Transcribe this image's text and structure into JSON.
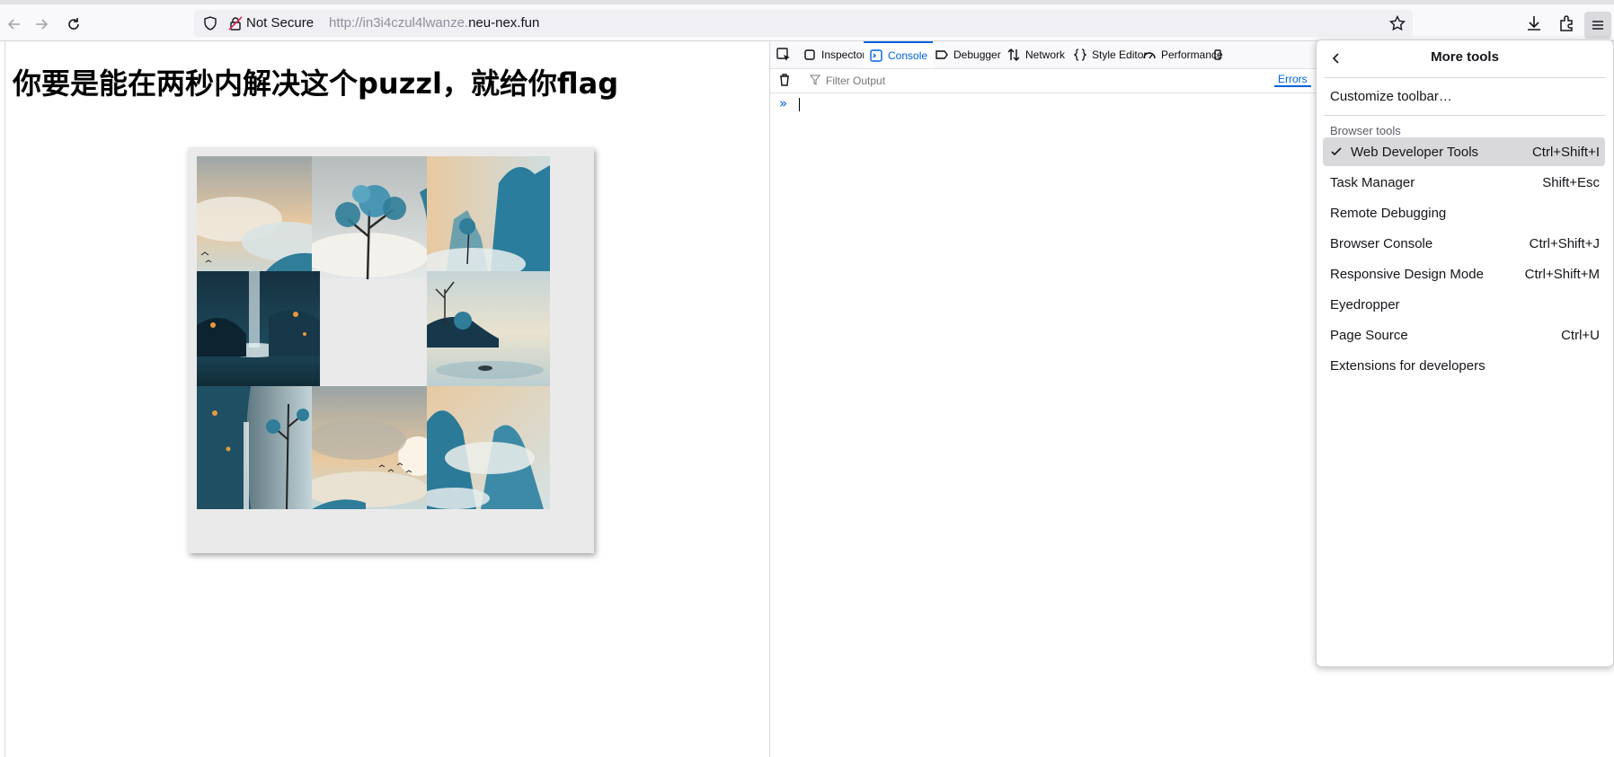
{
  "browser": {
    "url": {
      "not_secure_label": "Not Secure",
      "prefix": "http://in3i4czul4lwanze.",
      "host": "neu-nex.fun"
    }
  },
  "page": {
    "title": "你要是能在两秒内解决这个puzzl，就给你flag",
    "puzzle": {
      "tiles": [
        {
          "name": "puzzle-tile-clouds-birds",
          "empty": false
        },
        {
          "name": "puzzle-tile-blue-tree",
          "empty": false
        },
        {
          "name": "puzzle-tile-blue-mountains",
          "empty": false
        },
        {
          "name": "puzzle-tile-night-waterfall-lake",
          "empty": false
        },
        {
          "name": "puzzle-tile-empty",
          "empty": true
        },
        {
          "name": "puzzle-tile-island-lake",
          "empty": false
        },
        {
          "name": "puzzle-tile-waterfall-cliff",
          "empty": false
        },
        {
          "name": "puzzle-tile-sun-birds",
          "empty": false
        },
        {
          "name": "puzzle-tile-misty-peaks",
          "empty": false
        }
      ]
    }
  },
  "devtools": {
    "tabs": [
      {
        "label": "Inspector",
        "active": false
      },
      {
        "label": "Console",
        "active": true
      },
      {
        "label": "Debugger",
        "active": false
      },
      {
        "label": "Network",
        "active": false
      },
      {
        "label": "Style Editor",
        "active": false
      },
      {
        "label": "Performance",
        "active": false
      }
    ],
    "filter_placeholder": "Filter Output",
    "errors_label": "Errors",
    "prompt_symbol": "»"
  },
  "menu": {
    "title": "More tools",
    "customize": "Customize toolbar…",
    "section_label": "Browser tools",
    "items": [
      {
        "label": "Web Developer Tools",
        "shortcut": "Ctrl+Shift+I",
        "checked": true
      },
      {
        "label": "Task Manager",
        "shortcut": "Shift+Esc",
        "checked": false
      },
      {
        "label": "Remote Debugging",
        "shortcut": "",
        "checked": false
      },
      {
        "label": "Browser Console",
        "shortcut": "Ctrl+Shift+J",
        "checked": false
      },
      {
        "label": "Responsive Design Mode",
        "shortcut": "Ctrl+Shift+M",
        "checked": false
      },
      {
        "label": "Eyedropper",
        "shortcut": "",
        "checked": false
      },
      {
        "label": "Page Source",
        "shortcut": "Ctrl+U",
        "checked": false
      },
      {
        "label": "Extensions for developers",
        "shortcut": "",
        "checked": false
      }
    ]
  },
  "colors": {
    "accent": "#0061e0",
    "tile_teal": "#2f7d98",
    "tile_peach": "#e8c9a0",
    "tile_dark": "#16313f"
  }
}
